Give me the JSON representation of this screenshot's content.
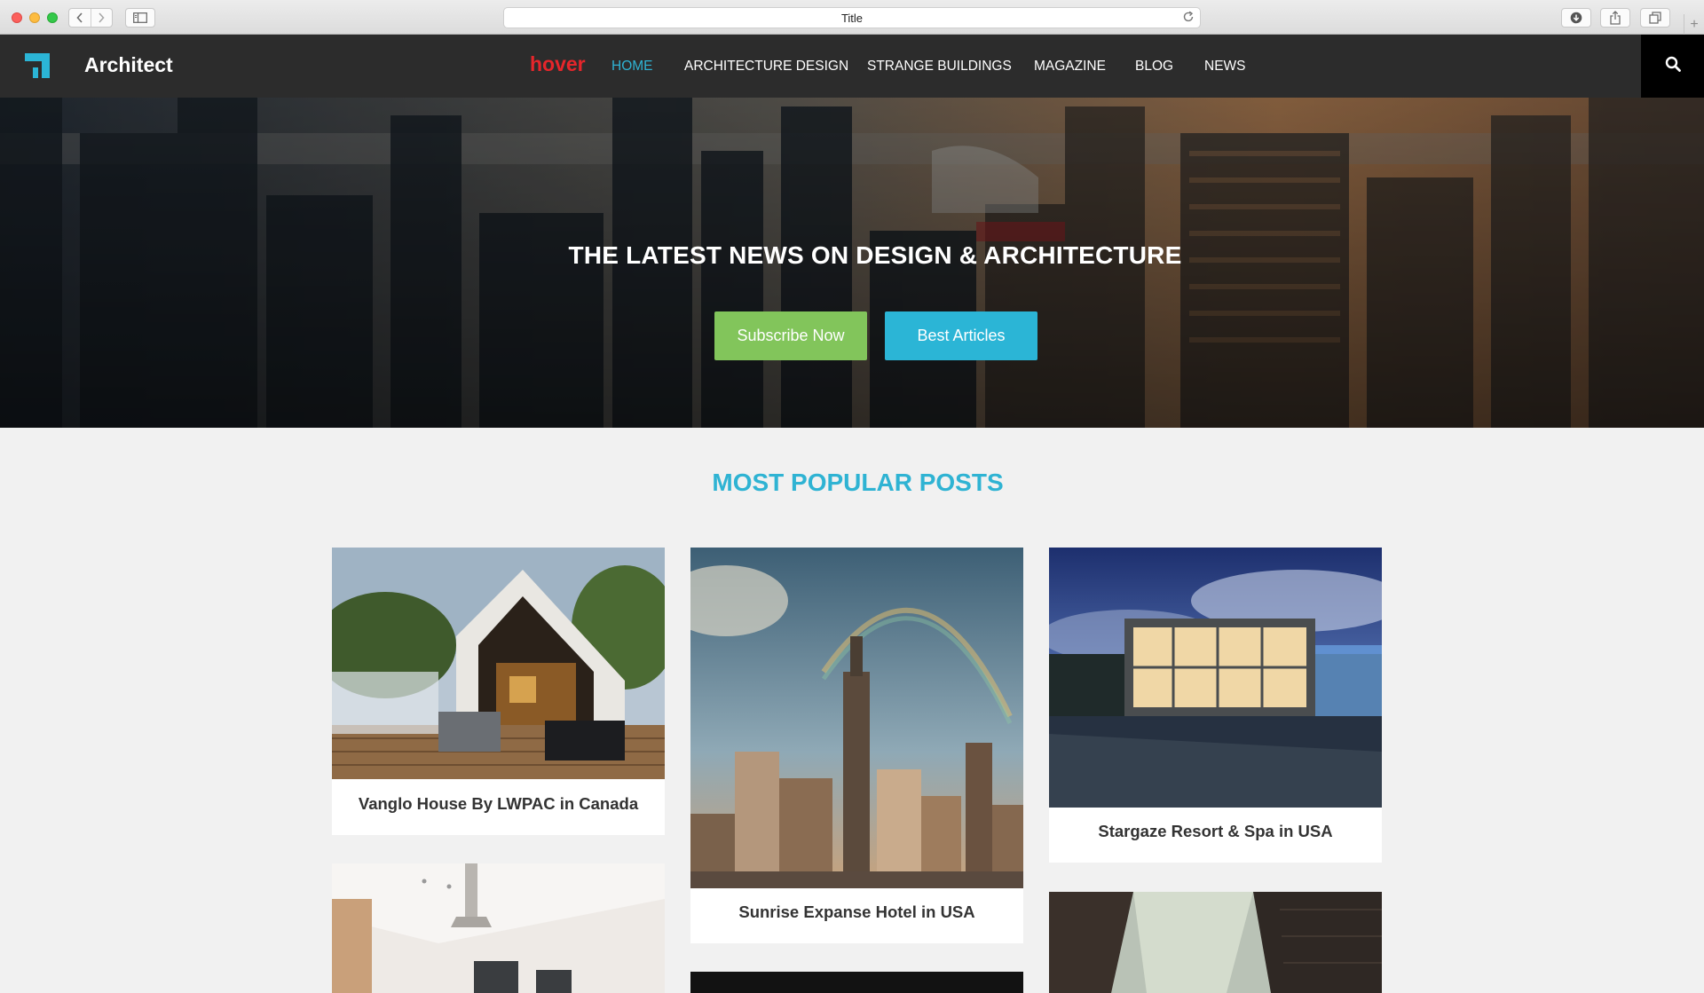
{
  "browser": {
    "tab_title": "Title",
    "icons": [
      "back-icon",
      "forward-icon",
      "sidebar-icon",
      "reload-icon",
      "download-icon",
      "share-icon",
      "tabs-icon",
      "plus-icon"
    ]
  },
  "header": {
    "brand": "Architect",
    "hover_label": "hover",
    "nav": [
      "HOME",
      "ARCHITECTURE DESIGN",
      "STRANGE BUILDINGS",
      "MAGAZINE",
      "BLOG",
      "NEWS"
    ],
    "active_nav": "HOME",
    "colors": {
      "background": "#2c2c2c",
      "active": "#2fb3d3",
      "hover_label": "#e6262b"
    }
  },
  "hero": {
    "title": "THE LATEST NEWS ON DESIGN & ARCHITECTURE",
    "subscribe_label": "Subscribe Now",
    "articles_label": "Best Articles",
    "colors": {
      "subscribe": "#82c55b",
      "articles": "#2bb5d6"
    }
  },
  "posts": {
    "heading": "MOST POPULAR POSTS",
    "items": [
      {
        "title": "Vanglo House By LWPAC in Canada"
      },
      {
        "title": "Sunrise Expanse Hotel in USA"
      },
      {
        "title": "Stargaze Resort & Spa in USA"
      }
    ]
  }
}
